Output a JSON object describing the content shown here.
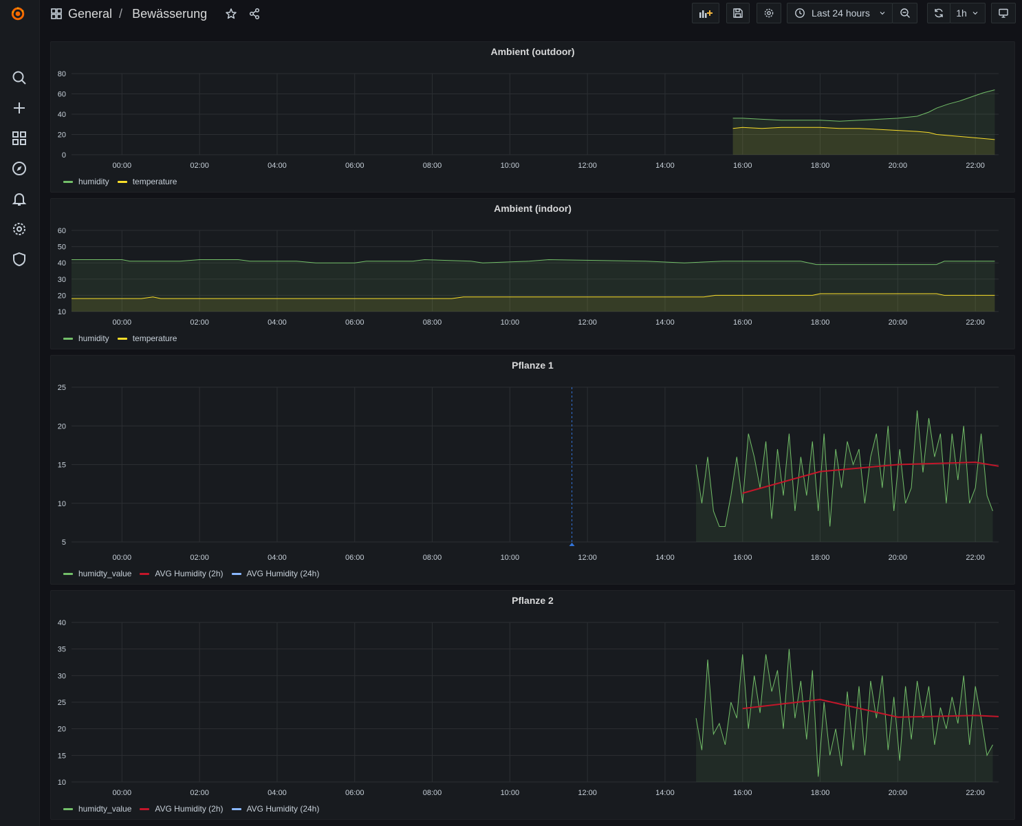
{
  "header": {
    "breadcrumb_folder": "General",
    "breadcrumb_separator": "/",
    "dashboard_title": "Bewässerung",
    "time_range": "Last 24 hours",
    "refresh_interval": "1h"
  },
  "sidebar": {
    "items": [
      {
        "icon": "search-icon"
      },
      {
        "icon": "plus-icon"
      },
      {
        "icon": "dashboards-icon"
      },
      {
        "icon": "compass-icon"
      },
      {
        "icon": "bell-icon"
      },
      {
        "icon": "gear-icon"
      },
      {
        "icon": "shield-icon"
      }
    ]
  },
  "colors": {
    "green": "#73bf69",
    "yellow": "#fade2a",
    "red": "#c4162a",
    "blue": "#8ab8ff",
    "annotation": "#3274d9"
  },
  "panels": [
    {
      "title": "Ambient (outdoor)",
      "legend": [
        "humidity",
        "temperature"
      ]
    },
    {
      "title": "Ambient (indoor)",
      "legend": [
        "humidity",
        "temperature"
      ]
    },
    {
      "title": "Pflanze 1",
      "legend": [
        "humidty_value",
        "AVG Humidity (2h)",
        "AVG Humidity (24h)"
      ]
    },
    {
      "title": "Pflanze 2",
      "legend": [
        "humidty_value",
        "AVG Humidity (2h)",
        "AVG Humidity (24h)"
      ]
    }
  ],
  "chart_data": [
    {
      "type": "area",
      "title": "Ambient (outdoor)",
      "x_ticks": [
        "00:00",
        "02:00",
        "04:00",
        "06:00",
        "08:00",
        "10:00",
        "12:00",
        "14:00",
        "16:00",
        "18:00",
        "20:00",
        "22:00"
      ],
      "x_range": [
        -1.3,
        22.6
      ],
      "ylim": [
        0,
        80
      ],
      "y_ticks": [
        0,
        20,
        40,
        60,
        80
      ],
      "grid": true,
      "legend_placement": "bottom-left",
      "series": [
        {
          "name": "humidity",
          "color": "#73bf69",
          "x": [
            15.75,
            16.0,
            16.5,
            17.0,
            17.5,
            18.0,
            18.5,
            19.0,
            19.5,
            20.0,
            20.5,
            20.8,
            21.0,
            21.3,
            21.6,
            21.9,
            22.2,
            22.5
          ],
          "values": [
            36,
            36,
            35,
            34,
            34,
            34,
            33,
            34,
            35,
            36,
            38,
            42,
            46,
            50,
            53,
            57,
            61,
            64
          ]
        },
        {
          "name": "temperature",
          "color": "#fade2a",
          "x": [
            15.75,
            16.0,
            16.5,
            17.0,
            17.5,
            18.0,
            18.5,
            19.0,
            19.5,
            20.0,
            20.5,
            20.8,
            21.0,
            21.3,
            21.6,
            21.9,
            22.2,
            22.5
          ],
          "values": [
            26,
            27,
            26,
            27,
            27,
            27,
            26,
            26,
            25,
            24,
            23,
            22,
            20,
            19,
            18,
            17,
            16,
            15
          ]
        }
      ]
    },
    {
      "type": "area",
      "title": "Ambient (indoor)",
      "x_ticks": [
        "00:00",
        "02:00",
        "04:00",
        "06:00",
        "08:00",
        "10:00",
        "12:00",
        "14:00",
        "16:00",
        "18:00",
        "20:00",
        "22:00"
      ],
      "x_range": [
        -1.3,
        22.6
      ],
      "ylim": [
        10,
        60
      ],
      "y_ticks": [
        10,
        20,
        30,
        40,
        50,
        60
      ],
      "grid": true,
      "legend_placement": "bottom-left",
      "series": [
        {
          "name": "humidity",
          "color": "#73bf69",
          "x": [
            -1.3,
            0.0,
            0.2,
            1.5,
            2.0,
            3.0,
            3.3,
            4.5,
            5.0,
            6.0,
            6.3,
            7.5,
            7.8,
            9.0,
            9.3,
            10.5,
            11.0,
            13.5,
            14.5,
            15.5,
            16.0,
            17.5,
            17.9,
            19.5,
            20.0,
            21.0,
            21.2,
            22.5
          ],
          "values": [
            42,
            42,
            41,
            41,
            42,
            42,
            41,
            41,
            40,
            40,
            41,
            41,
            42,
            41,
            40,
            41,
            42,
            41,
            40,
            41,
            41,
            41,
            39,
            39,
            39,
            39,
            41,
            41
          ]
        },
        {
          "name": "temperature",
          "color": "#fade2a",
          "x": [
            -1.3,
            0.0,
            0.5,
            0.8,
            1.0,
            3.0,
            6.0,
            8.5,
            8.8,
            12.0,
            15.0,
            15.3,
            17.0,
            17.8,
            18.0,
            21.0,
            21.2,
            22.5
          ],
          "values": [
            18,
            18,
            18,
            19,
            18,
            18,
            18,
            18,
            19,
            19,
            19,
            20,
            20,
            20,
            21,
            21,
            20,
            20
          ]
        }
      ]
    },
    {
      "type": "line",
      "title": "Pflanze 1",
      "x_ticks": [
        "00:00",
        "02:00",
        "04:00",
        "06:00",
        "08:00",
        "10:00",
        "12:00",
        "14:00",
        "16:00",
        "18:00",
        "20:00",
        "22:00"
      ],
      "x_range": [
        -1.3,
        22.6
      ],
      "ylim": [
        5,
        25
      ],
      "y_ticks": [
        5,
        10,
        15,
        20,
        25
      ],
      "grid": true,
      "legend_placement": "bottom-left",
      "annotation_x": 11.6,
      "series": [
        {
          "name": "humidty_value",
          "color": "#73bf69",
          "x": [
            14.8,
            14.95,
            15.1,
            15.25,
            15.4,
            15.55,
            15.7,
            15.85,
            16.0,
            16.15,
            16.3,
            16.45,
            16.6,
            16.75,
            16.9,
            17.05,
            17.2,
            17.35,
            17.5,
            17.65,
            17.8,
            17.95,
            18.1,
            18.25,
            18.4,
            18.55,
            18.7,
            18.85,
            19.0,
            19.15,
            19.3,
            19.45,
            19.6,
            19.75,
            19.9,
            20.05,
            20.2,
            20.35,
            20.5,
            20.65,
            20.8,
            20.95,
            21.1,
            21.25,
            21.4,
            21.55,
            21.7,
            21.85,
            22.0,
            22.15,
            22.3,
            22.45
          ],
          "values": [
            15,
            10,
            16,
            9,
            7,
            7,
            11,
            16,
            10,
            19,
            16,
            12,
            18,
            8,
            17,
            11,
            19,
            9,
            16,
            11,
            18,
            9,
            19,
            7,
            17,
            12,
            18,
            15,
            17,
            10,
            16,
            19,
            12,
            20,
            9,
            17,
            10,
            12,
            22,
            14,
            21,
            16,
            19,
            10,
            19,
            13,
            20,
            10,
            12,
            19,
            11,
            9
          ]
        },
        {
          "name": "AVG Humidity (2h)",
          "color": "#c4162a",
          "x": [
            16.0,
            18.0,
            20.0,
            22.0,
            22.6
          ],
          "values": [
            11.3,
            14.1,
            15.0,
            15.3,
            14.8
          ]
        },
        {
          "name": "AVG Humidity (24h)",
          "color": "#8ab8ff",
          "x": [],
          "values": []
        }
      ]
    },
    {
      "type": "line",
      "title": "Pflanze 2",
      "x_ticks": [
        "00:00",
        "02:00",
        "04:00",
        "06:00",
        "08:00",
        "10:00",
        "12:00",
        "14:00",
        "16:00",
        "18:00",
        "20:00",
        "22:00"
      ],
      "x_range": [
        -1.3,
        22.6
      ],
      "ylim": [
        10,
        40
      ],
      "y_ticks": [
        10,
        15,
        20,
        25,
        30,
        35,
        40
      ],
      "grid": true,
      "legend_placement": "bottom-left",
      "series": [
        {
          "name": "humidty_value",
          "color": "#73bf69",
          "x": [
            14.8,
            14.95,
            15.1,
            15.25,
            15.4,
            15.55,
            15.7,
            15.85,
            16.0,
            16.15,
            16.3,
            16.45,
            16.6,
            16.75,
            16.9,
            17.05,
            17.2,
            17.35,
            17.5,
            17.65,
            17.8,
            17.95,
            18.1,
            18.25,
            18.4,
            18.55,
            18.7,
            18.85,
            19.0,
            19.15,
            19.3,
            19.45,
            19.6,
            19.75,
            19.9,
            20.05,
            20.2,
            20.35,
            20.5,
            20.65,
            20.8,
            20.95,
            21.1,
            21.25,
            21.4,
            21.55,
            21.7,
            21.85,
            22.0,
            22.15,
            22.3,
            22.45
          ],
          "values": [
            22,
            16,
            33,
            19,
            21,
            17,
            25,
            22,
            34,
            20,
            30,
            23,
            34,
            27,
            31,
            20,
            35,
            22,
            29,
            18,
            31,
            11,
            25,
            15,
            20,
            13,
            27,
            16,
            28,
            15,
            29,
            22,
            30,
            16,
            26,
            14,
            28,
            18,
            29,
            22,
            28,
            17,
            24,
            20,
            26,
            21,
            30,
            17,
            28,
            22,
            15,
            17
          ]
        },
        {
          "name": "AVG Humidity (2h)",
          "color": "#c4162a",
          "x": [
            16.0,
            18.0,
            20.0,
            22.0,
            22.6
          ],
          "values": [
            23.8,
            25.5,
            22.2,
            22.5,
            22.3
          ]
        },
        {
          "name": "AVG Humidity (24h)",
          "color": "#8ab8ff",
          "x": [],
          "values": []
        }
      ]
    }
  ]
}
